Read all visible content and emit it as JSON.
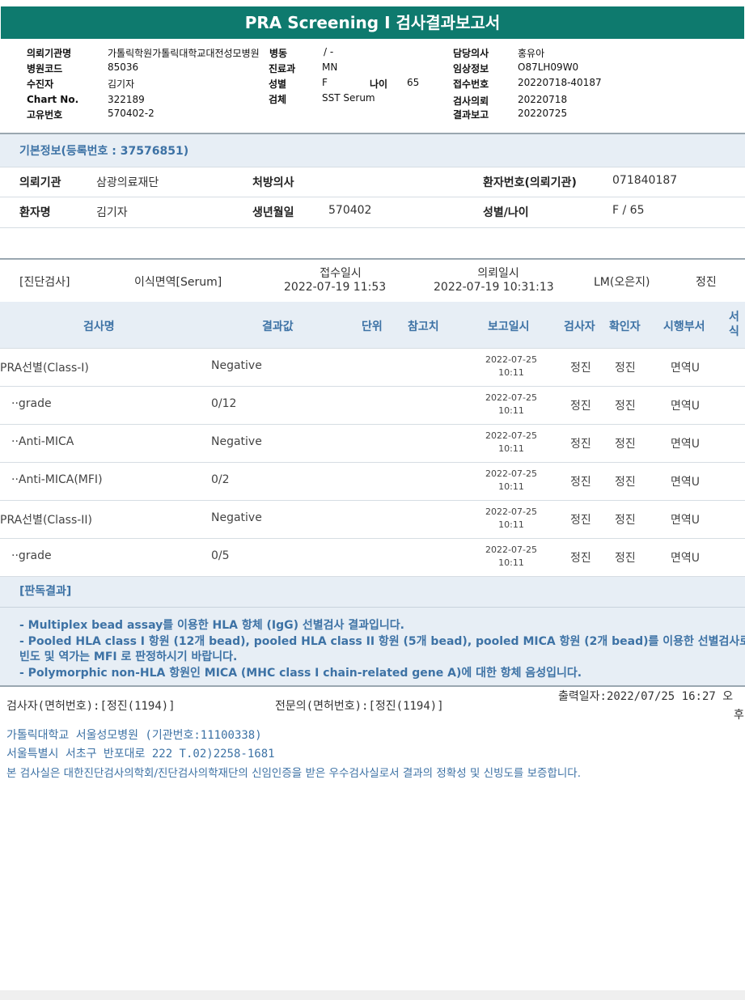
{
  "title": "PRA Screening I 검사결과보고서",
  "header": {
    "requesting_institution_label": "의뢰기관명",
    "requesting_institution_value": "가톨릭학원가톨릭대학교대전성모병원",
    "ward_label": "병동",
    "ward_value": "/ -",
    "doctor_label": "담당의사",
    "doctor_value": "홍유아",
    "hospital_code_label": "병원코드",
    "hospital_code_value": "85036",
    "department_label": "진료과",
    "department_value": "MN",
    "clinical_info_label": "임상정보",
    "clinical_info_value": "O87LH09W0",
    "patient_label": "수진자",
    "patient_value": "김기자",
    "sex_label": "성별",
    "sex_value": "F",
    "age_label": "나이",
    "age_value": "65",
    "receipt_no_label": "접수번호",
    "receipt_no_value": "20220718-40187",
    "chart_no_label": "Chart No.",
    "chart_no_value": "322189",
    "specimen_label": "검체",
    "specimen_value": "SST Serum",
    "test_request_label": "검사의뢰",
    "test_request_value": "20220718",
    "unique_no_label": "고유번호",
    "unique_no_value": "570402-2",
    "result_report_label": "결과보고",
    "result_report_value": "20220725"
  },
  "basic_info": {
    "heading": "기본정보(등록번호 : 37576851)",
    "institution_label": "의뢰기관",
    "institution_value": "삼광의료재단",
    "prescriber_label": "처방의사",
    "prescriber_value": "",
    "patient_no_label": "환자번호(의뢰기관)",
    "patient_no_value": "071840187",
    "patient_name_label": "환자명",
    "patient_name_value": "김기자",
    "birth_label": "생년월일",
    "birth_value": "570402",
    "sex_age_label": "성별/나이",
    "sex_age_value": "F / 65"
  },
  "exam": {
    "category": "[진단검사]",
    "name": "이식면역[Serum]",
    "received_label": "접수일시",
    "received_value": "2022-07-19 11:53",
    "requested_label": "의뢰일시",
    "requested_value": "2022-07-19 10:31:13",
    "lm": "LM(오은지)",
    "person": "정진"
  },
  "table": {
    "headers": [
      "검사명",
      "결과값",
      "단위",
      "참고치",
      "보고일시",
      "검사자",
      "확인자",
      "시행부서",
      "서식"
    ],
    "rows": [
      {
        "name": "PRA선별(Class-I)",
        "value": "Negative",
        "unit": "",
        "ref": "",
        "date": "2022-07-25",
        "time": "10:11",
        "tester": "정진",
        "checker": "정진",
        "dept": "면역U"
      },
      {
        "name": "··grade",
        "value": "0/12",
        "unit": "",
        "ref": "",
        "date": "2022-07-25",
        "time": "10:11",
        "tester": "정진",
        "checker": "정진",
        "dept": "면역U"
      },
      {
        "name": "··Anti-MICA",
        "value": "Negative",
        "unit": "",
        "ref": "",
        "date": "2022-07-25",
        "time": "10:11",
        "tester": "정진",
        "checker": "정진",
        "dept": "면역U"
      },
      {
        "name": "··Anti-MICA(MFI)",
        "value": "0/2",
        "unit": "",
        "ref": "",
        "date": "2022-07-25",
        "time": "10:11",
        "tester": "정진",
        "checker": "정진",
        "dept": "면역U"
      },
      {
        "name": "PRA선별(Class-II)",
        "value": "Negative",
        "unit": "",
        "ref": "",
        "date": "2022-07-25",
        "time": "10:11",
        "tester": "정진",
        "checker": "정진",
        "dept": "면역U"
      },
      {
        "name": "··grade",
        "value": "0/5",
        "unit": "",
        "ref": "",
        "date": "2022-07-25",
        "time": "10:11",
        "tester": "정진",
        "checker": "정진",
        "dept": "면역U"
      }
    ]
  },
  "interpretation": {
    "heading": "[판독결과]",
    "lines": [
      "- Multiplex bead assay를 이용한 HLA 항체 (IgG) 선별검사 결과입니다.",
      "- Pooled HLA class I 항원 (12개 bead), pooled HLA class II 항원 (5개 bead), pooled MICA 항원 (2개 bead)를 이용한 선별검사로서, 항체",
      "빈도 및 역가는 MFI 로 판정하시기 바랍니다.",
      "- Polymorphic non-HLA 항원인 MICA (MHC class I chain-related gene A)에 대한 항체 음성입니다."
    ]
  },
  "footer": {
    "tester": "검사자(면허번호):[정진(1194)]",
    "specialist": "전문의(면허번호):[정진(1194)]",
    "print_date": "출력일자:2022/07/25 16:27 오",
    "print_date_suffix": "후",
    "hospital": "가톨릭대학교 서울성모병원 (기관번호:11100338)",
    "address": "서울특별시 서초구 반포대로 222 T.02)2258-1681",
    "certification": "본 검사실은 대한진단검사의학회/진단검사의학재단의 신임인증을 받은 우수검사실로서 결과의 정확성 및 신빙도를 보증합니다."
  }
}
